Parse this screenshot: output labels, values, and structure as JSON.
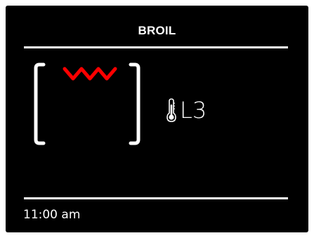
{
  "header": {
    "mode": "BROIL"
  },
  "oven": {
    "element_icon": "broil-heating-element-icon",
    "element_color": "#ff0000"
  },
  "temperature": {
    "icon": "thermometer-icon",
    "level": "L3"
  },
  "status": {
    "time": "11:00 am"
  },
  "colors": {
    "background": "#000000",
    "foreground": "#ffffff",
    "accent": "#ff0000"
  }
}
